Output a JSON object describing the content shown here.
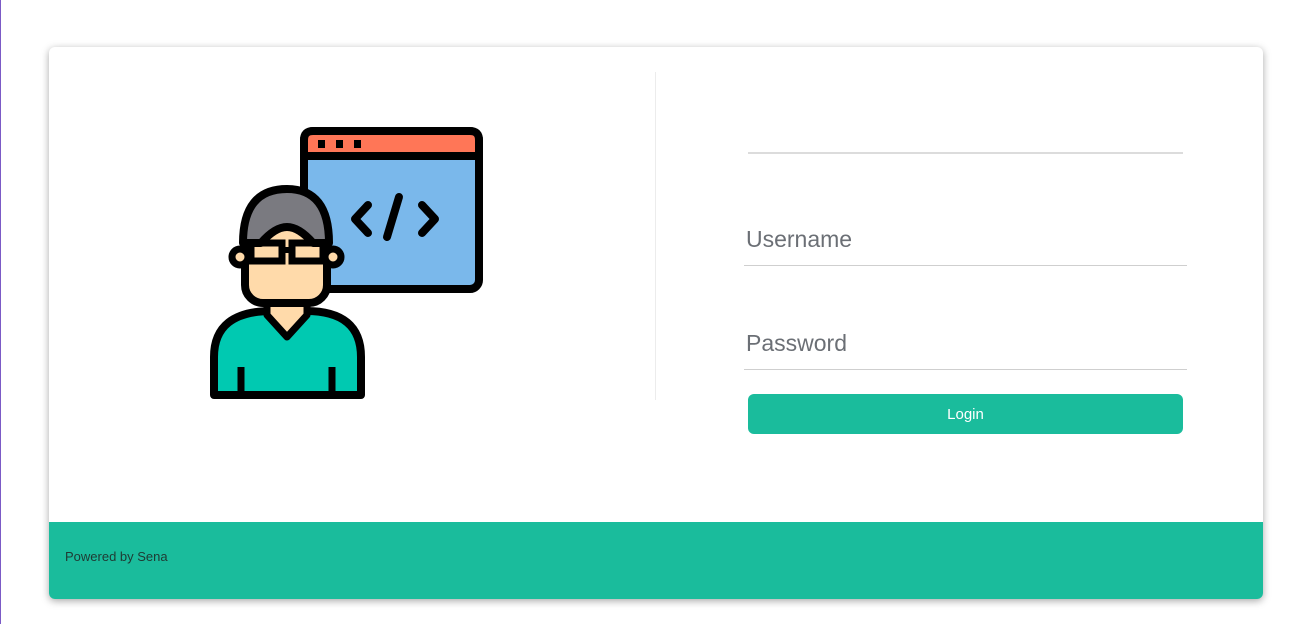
{
  "form": {
    "username_placeholder": "Username",
    "password_placeholder": "Password",
    "username_value": "",
    "password_value": "",
    "login_label": "Login"
  },
  "footer": {
    "text": "Powered by Sena"
  },
  "colors": {
    "accent": "#1abc9c",
    "window_header": "#ff7657",
    "window_body": "#7ab8eb",
    "shirt": "#00c9b1",
    "skin": "#ffdaaa",
    "hair": "#7a7a80"
  },
  "icons": {
    "illustration": "developer-at-code-window-icon"
  }
}
